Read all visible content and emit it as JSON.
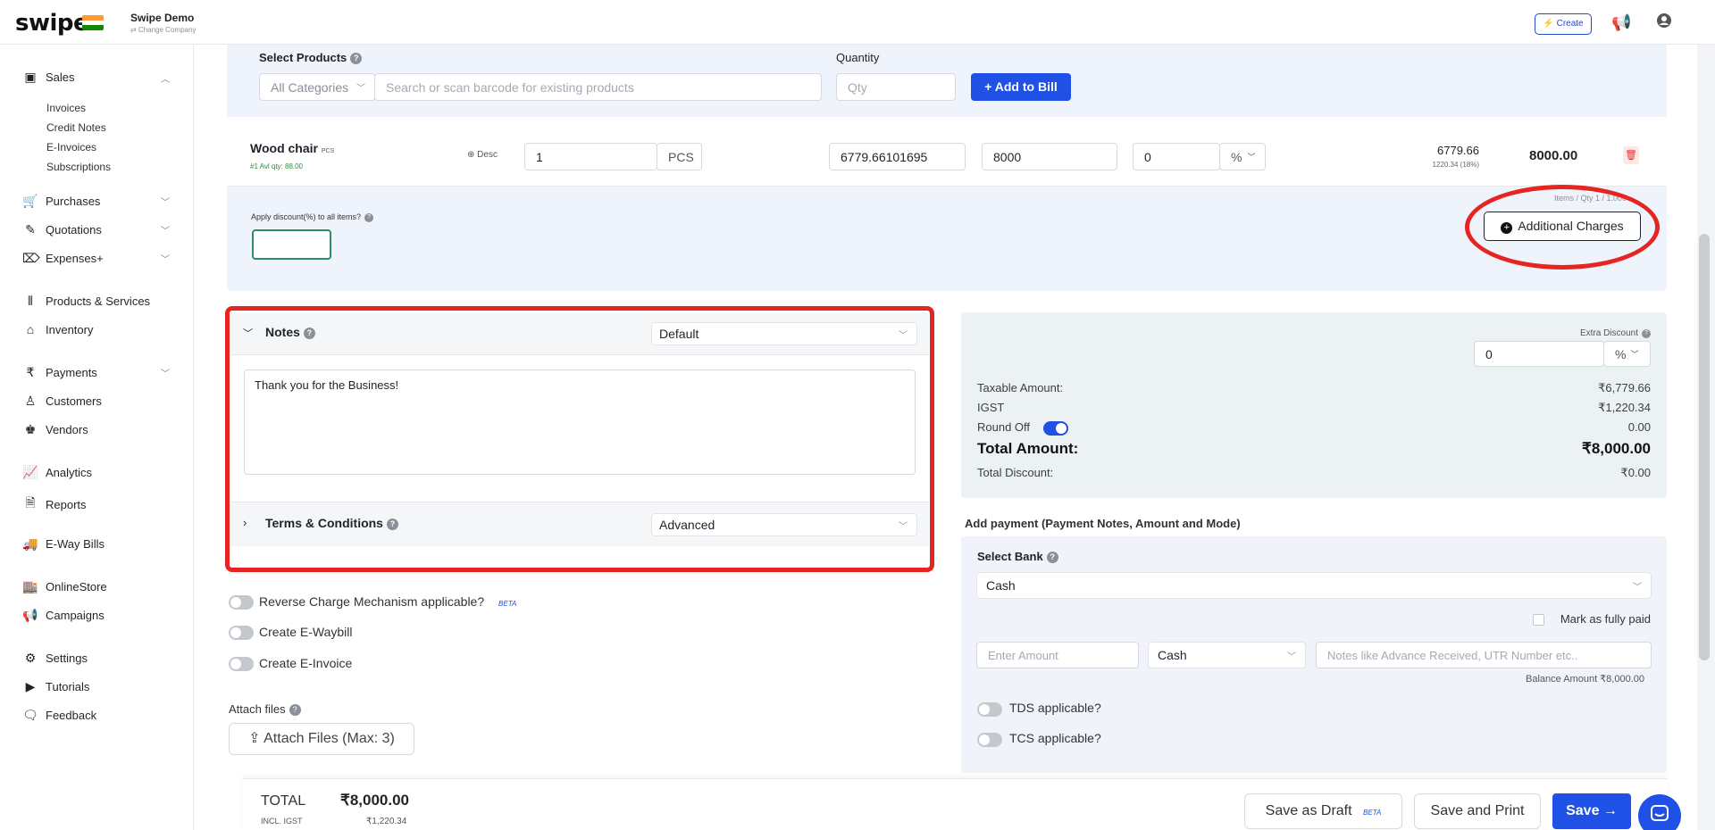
{
  "brand": {
    "logo": "swipe",
    "company_name": "Swipe Demo",
    "change_company": "⇄ Change Company"
  },
  "topbar": {
    "create_label": "⚡ Create"
  },
  "sidebar": {
    "sales": "Sales",
    "sales_sub": [
      "Invoices",
      "Credit Notes",
      "E-Invoices",
      "Subscriptions"
    ],
    "purchases": "Purchases",
    "quotations": "Quotations",
    "expenses": "Expenses+",
    "products": "Products & Services",
    "inventory": "Inventory",
    "payments": "Payments",
    "customers": "Customers",
    "vendors": "Vendors",
    "analytics": "Analytics",
    "reports": "Reports",
    "eway": "E-Way Bills",
    "online_store": "OnlineStore",
    "campaigns": "Campaigns",
    "settings": "Settings",
    "tutorials": "Tutorials",
    "feedback": "Feedback"
  },
  "products": {
    "select_label": "Select Products",
    "category": "All Categories",
    "search_placeholder": "Search or scan barcode for existing products",
    "qty_label": "Quantity",
    "qty_placeholder": "Qty",
    "add_button": "+ Add to Bill"
  },
  "item": {
    "name": "Wood chair",
    "unit_tag": "PCS",
    "avl": "#1 Avl qty: 88.00",
    "desc": "Desc",
    "qty": "1",
    "unit": "PCS",
    "unit_price": "6779.66101695",
    "price_with_tax": "8000",
    "discount": "0",
    "discount_type": "%",
    "net": "6779.66",
    "tax_line": "1220.34 (18%)",
    "total": "8000.00"
  },
  "discount_all": {
    "label": "Apply discount(%) to all items?",
    "items_qty": "Items / Qty 1 / 1.000"
  },
  "additional_charges": "Additional Charges",
  "notes": {
    "title": "Notes",
    "template": "Default",
    "text": "Thank you for the Business!"
  },
  "terms": {
    "title": "Terms & Conditions",
    "template": "Advanced"
  },
  "options": {
    "reverse_charge": "Reverse Charge Mechanism applicable?",
    "beta": "BETA",
    "eway": "Create E-Waybill",
    "einvoice": "Create E-Invoice"
  },
  "attach": {
    "label": "Attach files",
    "button": "Attach Files (Max: 3)"
  },
  "summary": {
    "extra_discount_label": "Extra Discount",
    "extra_discount_value": "0",
    "extra_discount_type": "%",
    "taxable_label": "Taxable Amount:",
    "taxable_value": "₹6,779.66",
    "igst_label": "IGST",
    "igst_value": "₹1,220.34",
    "roundoff_label": "Round Off",
    "roundoff_value": "0.00",
    "total_label": "Total Amount:",
    "total_value": "₹8,000.00",
    "total_discount_label": "Total Discount:",
    "total_discount_value": "₹0.00"
  },
  "payment": {
    "title": "Add payment (Payment Notes, Amount and Mode)",
    "bank_label": "Select Bank",
    "bank_value": "Cash",
    "mark_paid": "Mark as fully paid",
    "amount_placeholder": "Enter Amount",
    "mode": "Cash",
    "notes_placeholder": "Notes like Advance Received, UTR Number etc..",
    "balance": "Balance Amount  ₹8,000.00",
    "tds": "TDS applicable?",
    "tcs": "TCS applicable?"
  },
  "footer": {
    "total_label": "TOTAL",
    "total_value": "₹8,000.00",
    "incl_label": "INCL. IGST",
    "incl_value": "₹1,220.34",
    "draft": "Save as Draft",
    "beta": "BETA",
    "print": "Save and Print",
    "save": "Save →"
  },
  "colors": {
    "primary": "#1f51e6",
    "annotation": "#e52521"
  }
}
